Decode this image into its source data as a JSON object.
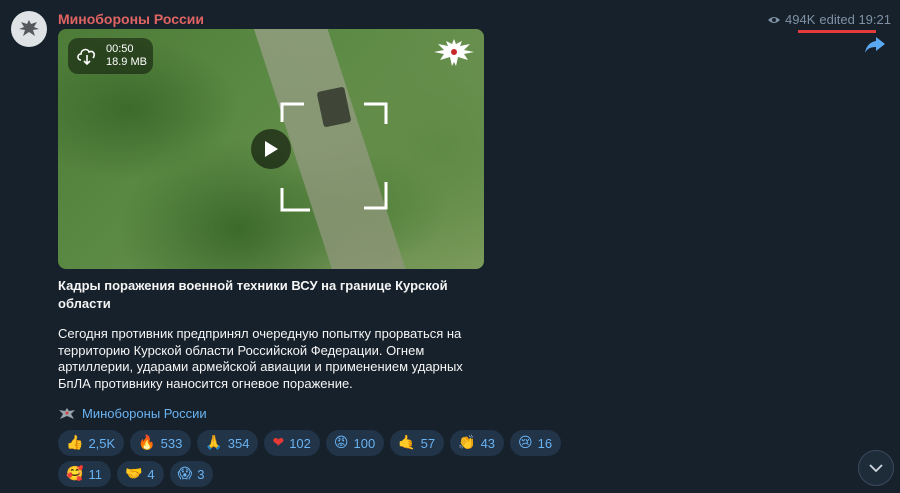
{
  "channel": {
    "name": "Минобороны России",
    "avatar_icon": "mod-emblem-icon"
  },
  "meta": {
    "views": "494K",
    "edited_time": "edited 19:21"
  },
  "video": {
    "duration": "00:50",
    "size": "18.9 MB",
    "download_icon": "cloud-download-icon",
    "play_icon": "play-icon"
  },
  "post": {
    "title": "Кадры поражения военной техники ВСУ на границе Курской области",
    "body": "Сегодня противник предпринял очередную попытку прорваться на территорию Курской области Российской Федерации. Огнем артиллерии, ударами армейской авиации и применением ударных БпЛА противнику наносится огневое поражение.",
    "signature": "Минобороны России"
  },
  "reactions": [
    {
      "emoji": "👍",
      "count": "2,5K"
    },
    {
      "emoji": "🔥",
      "count": "533"
    },
    {
      "emoji": "🙏",
      "count": "354"
    },
    {
      "emoji": "❤",
      "count": "102"
    },
    {
      "emoji": "😡",
      "count": "100"
    },
    {
      "emoji": "🤙",
      "count": "57"
    },
    {
      "emoji": "👏",
      "count": "43"
    },
    {
      "emoji": "😢",
      "count": "16"
    },
    {
      "emoji": "🥰",
      "count": "11"
    },
    {
      "emoji": "🤝",
      "count": "4"
    },
    {
      "emoji": "😱",
      "count": "3"
    }
  ],
  "colors": {
    "background": "#17212b",
    "channel_name": "#e06463",
    "accent": "#6ab3f3",
    "reaction_bg": "#213448",
    "meta": "#7f91a4"
  }
}
